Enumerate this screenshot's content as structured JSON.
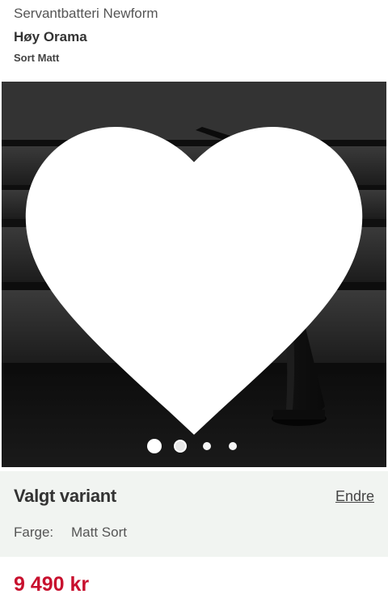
{
  "header": {
    "brand_line": "Servantbatteri Newform",
    "product_name": "Høy Orama",
    "variant_name": "Sort Matt"
  },
  "gallery": {
    "image_subject": "black-matte-basin-faucet",
    "favorite_icon": "heart-icon",
    "slide_count": 4,
    "active_slide": 1
  },
  "variant": {
    "title": "Valgt variant",
    "change_label": "Endre",
    "color_label": "Farge:",
    "color_value": "Matt Sort"
  },
  "price": {
    "text": "9 490 kr",
    "color": "#c8102e"
  }
}
